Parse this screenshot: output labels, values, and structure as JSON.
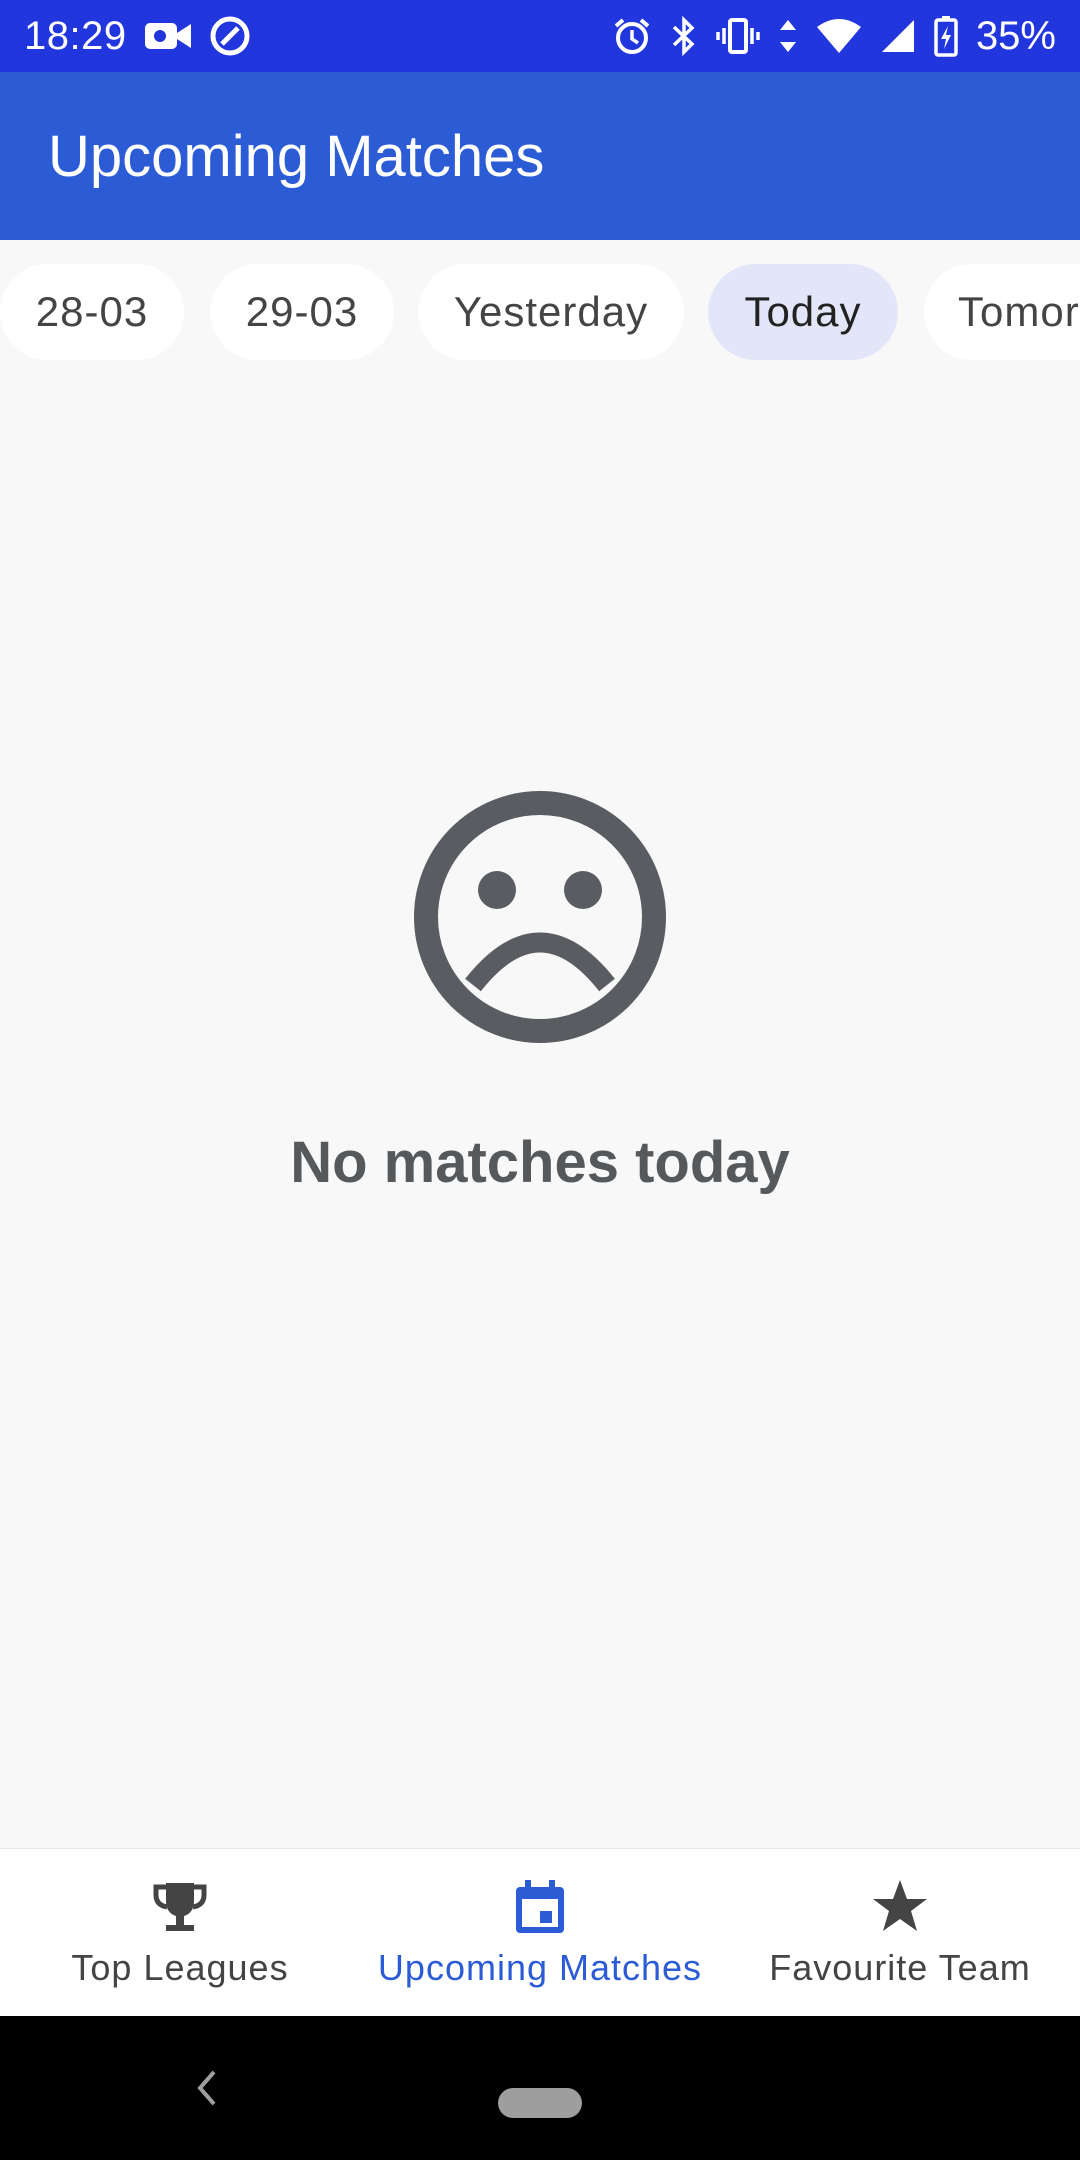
{
  "status_bar": {
    "time": "18:29",
    "battery_percent": "35%",
    "icons": [
      "video-icon",
      "data-saver-icon",
      "alarm-icon",
      "bluetooth-icon",
      "vibrate-icon",
      "wifi-icon",
      "signal-icon",
      "battery-charging-icon"
    ],
    "background_color": "#2236de"
  },
  "app_bar": {
    "title": "Upcoming Matches",
    "background_color": "#2c5bd6"
  },
  "date_chips": {
    "items": [
      {
        "label": "28-03",
        "selected": false
      },
      {
        "label": "29-03",
        "selected": false
      },
      {
        "label": "Yesterday",
        "selected": false
      },
      {
        "label": "Today",
        "selected": true
      },
      {
        "label": "Tomorrow",
        "selected": false
      }
    ]
  },
  "empty_state": {
    "icon": "sad-face-icon",
    "message": "No matches today"
  },
  "bottom_nav": {
    "items": [
      {
        "label": "Top Leagues",
        "icon": "trophy-icon",
        "active": false
      },
      {
        "label": "Upcoming Matches",
        "icon": "calendar-icon",
        "active": true
      },
      {
        "label": "Favourite Team",
        "icon": "star-icon",
        "active": false
      }
    ],
    "active_color": "#2c5bd6"
  }
}
